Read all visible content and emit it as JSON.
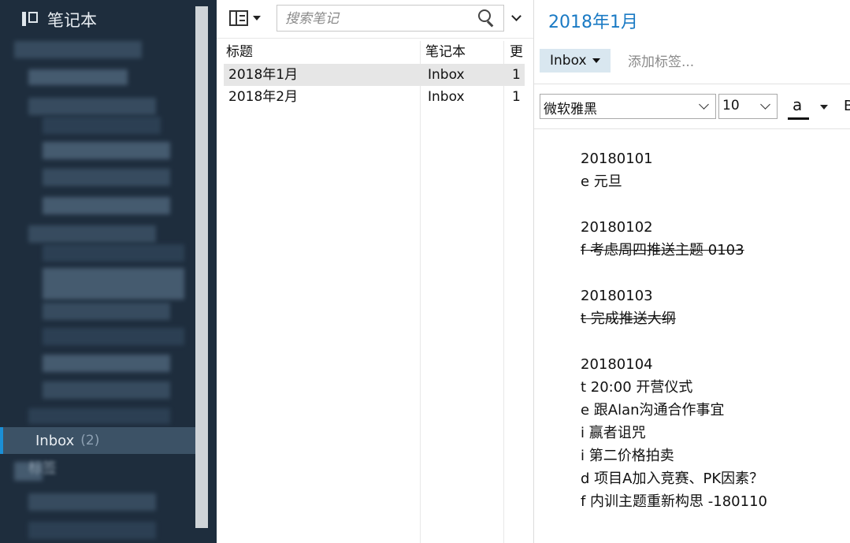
{
  "sidebar": {
    "header": "笔记本",
    "selected_item": {
      "label": "Inbox",
      "count": "(2)"
    },
    "tags_label": "标签"
  },
  "note_list": {
    "search_placeholder": "搜索笔记",
    "columns": [
      "标题",
      "笔记本",
      "更"
    ],
    "rows": [
      {
        "title": "2018年1月",
        "notebook": "Inbox",
        "updated": "1",
        "selected": true
      },
      {
        "title": "2018年2月",
        "notebook": "Inbox",
        "updated": "1",
        "selected": false
      }
    ]
  },
  "editor": {
    "title": "2018年1月",
    "notebook": "Inbox",
    "add_tag": "添加标签...",
    "font_family": "微软雅黑",
    "font_size": "10",
    "font_color_letter": "a",
    "bold_label": "B",
    "content": [
      {
        "text": "20180101",
        "strike": false
      },
      {
        "text": "e 元旦",
        "strike": false
      },
      {
        "text": "",
        "strike": false
      },
      {
        "text": "20180102",
        "strike": false
      },
      {
        "text": "f 考虑周四推送主题 0103",
        "strike": true
      },
      {
        "text": "",
        "strike": false
      },
      {
        "text": "20180103",
        "strike": false
      },
      {
        "text": "t 完成推送大纲",
        "strike": true
      },
      {
        "text": "",
        "strike": false
      },
      {
        "text": "20180104",
        "strike": false
      },
      {
        "text": "t 20:00 开营仪式",
        "strike": false
      },
      {
        "text": "e 跟Alan沟通合作事宜",
        "strike": false
      },
      {
        "text": "i 赢者诅咒",
        "strike": false
      },
      {
        "text": "i 第二价格拍卖",
        "strike": false
      },
      {
        "text": "d 项目A加入竞赛、PK因素？",
        "strike": false
      },
      {
        "text": "f 内训主题重新构思 -180110",
        "strike": false
      }
    ]
  }
}
